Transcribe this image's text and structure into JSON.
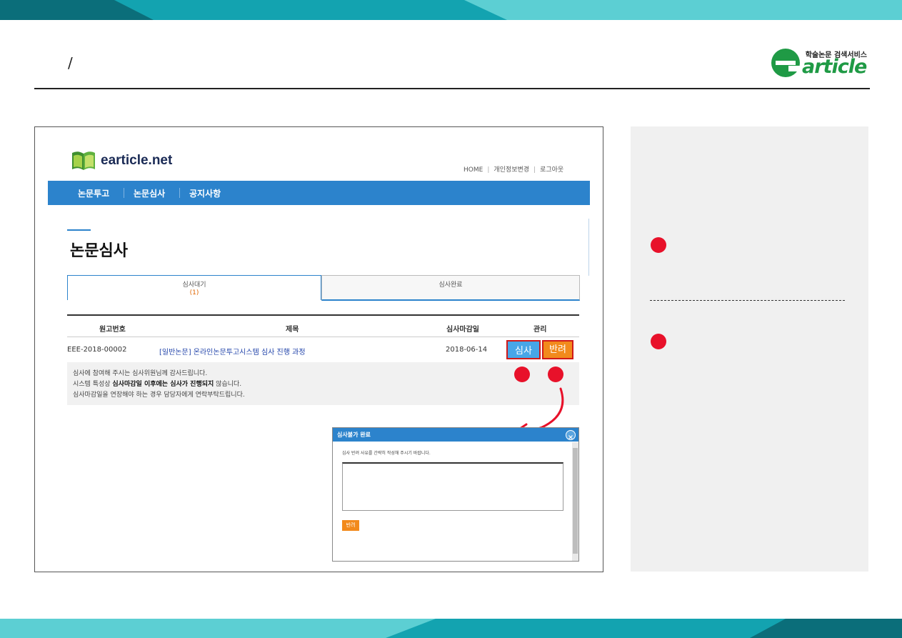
{
  "slide": {
    "mark": "/",
    "brand_tag": "학술논문 검색서비스",
    "brand_word": "article"
  },
  "site": {
    "name": "earticle.net",
    "util_nav": [
      "HOME",
      "개인정보변경",
      "로그아웃"
    ],
    "nav": [
      "논문투고",
      "논문심사",
      "공지사항"
    ]
  },
  "page": {
    "title": "논문심사",
    "tabs": [
      {
        "label": "심사대기",
        "count": "(1)"
      },
      {
        "label": "심사완료"
      }
    ]
  },
  "table": {
    "headers": [
      "원고번호",
      "제목",
      "심사마감일",
      "관리"
    ],
    "rows": [
      {
        "id": "EEE-2018-00002",
        "title": "[일반논문] 온라인논문투고시스템 심사 진행 과정",
        "deadline": "2018-06-14",
        "actions": [
          "심사",
          "반려"
        ]
      }
    ]
  },
  "notice": {
    "line1": "심사에 참여해 주시는 심사위원님께 감사드립니다.",
    "line2_pre": "시스템 특성상 ",
    "line2_b1": "심사마감일 이후에는 심사가 진행되지",
    "line2_post": " 않습니다.",
    "line3": "심사마감일을 연장해야 하는 경우 담당자에게 연락부탁드립니다."
  },
  "popup": {
    "title": "심사불가 완료",
    "description": "심사 반려 사유를 간략히 작성해 주시기 바랍니다.",
    "textarea_value": "",
    "submit_label": "반려"
  },
  "colors": {
    "nav_blue": "#2c83cc",
    "accent_red": "#e8112a",
    "orange": "#f28a1c",
    "teal_dark": "#0e7c8c",
    "teal_light": "#5ccfd3"
  }
}
